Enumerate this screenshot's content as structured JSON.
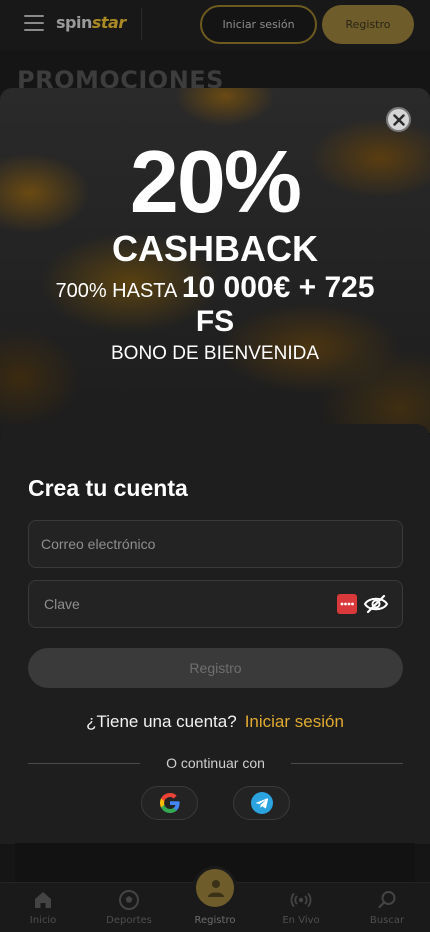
{
  "header": {
    "logo_part1": "spin",
    "logo_part2": "star",
    "login_label": "Iniciar sesión",
    "register_label": "Registro"
  },
  "page": {
    "title": "PROMOCIONES"
  },
  "banner": {
    "percent": "20%",
    "headline": "CASHBACK",
    "offer_prefix": "700% HASTA",
    "offer_amount": "10 000€ + 725",
    "offer_suffix": "FS",
    "subtitle": "BONO DE BIENVENIDA",
    "close_icon": "close-icon"
  },
  "form": {
    "title": "Crea tu cuenta",
    "email_placeholder": "Correo electrónico",
    "email_value": "",
    "password_placeholder": "Clave",
    "password_value": "",
    "submit_label": "Registro",
    "have_account_question": "¿Tiene una cuenta?",
    "login_link": "Iniciar sesión",
    "continue_with": "O continuar con",
    "social": [
      "google",
      "telegram"
    ]
  },
  "bottom_nav": {
    "items": [
      {
        "label": "Inicio",
        "icon": "home-icon"
      },
      {
        "label": "Deportes",
        "icon": "soccer-ball-icon"
      },
      {
        "label": "Registro",
        "icon": "user-icon"
      },
      {
        "label": "En Vivo",
        "icon": "live-broadcast-icon"
      },
      {
        "label": "Buscar",
        "icon": "search-icon"
      }
    ]
  },
  "colors": {
    "accent": "#e0a92f",
    "brand_button": "#6e5d2b",
    "panel_bg": "#1e1e1e",
    "disabled_button": "#3a3a3a"
  }
}
